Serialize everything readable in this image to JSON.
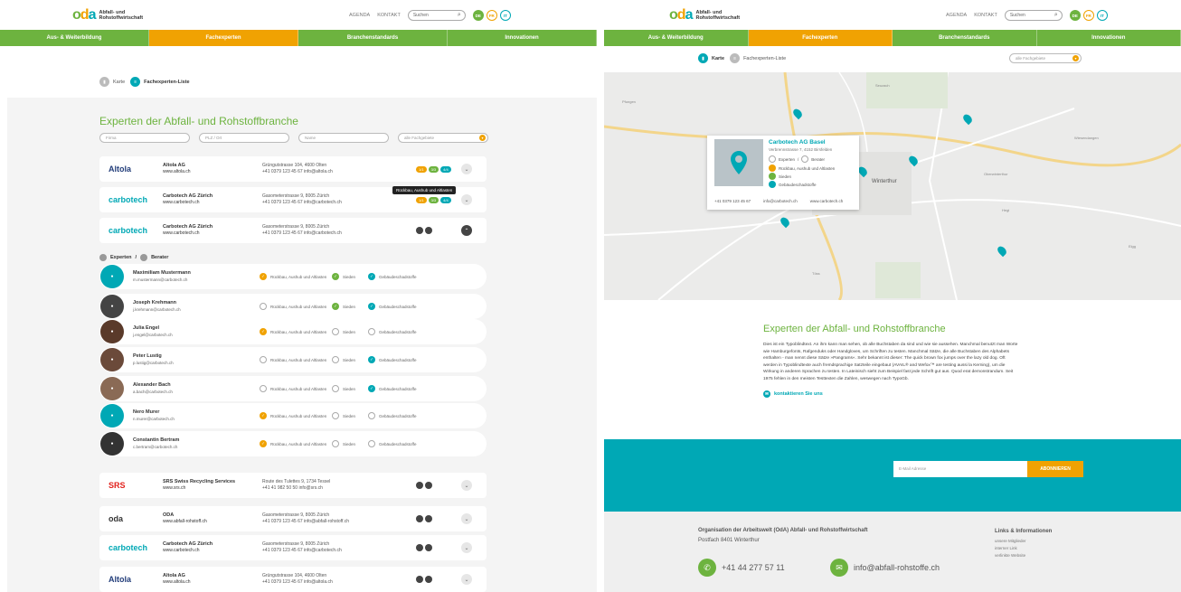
{
  "brand": {
    "mark": "oda",
    "line1": "Abfall- und",
    "line2": "Rohstoffwirtschaft"
  },
  "header": {
    "agenda": "AGENDA",
    "kontakt": "KONTAKT",
    "search_placeholder": "Suchen",
    "langs": [
      "DE",
      "FR",
      "IT"
    ]
  },
  "nav": [
    "Aus- & Weiterbildung",
    "Fachexperten",
    "Branchenstandards",
    "Innovationen"
  ],
  "toggle": {
    "map": "Karte",
    "list": "Fachexperten-Liste"
  },
  "left": {
    "heading": "Experten der Abfall- und Rohstoffbranche",
    "filters": [
      "Firma",
      "PLZ / Ort",
      "Name",
      "alle Fachgebiete"
    ],
    "tooltip": "Rückbau, Aushub und Altlasten",
    "companies_top": [
      {
        "logo": "Altola",
        "name": "Altola AG",
        "web": "www.altola.ch",
        "addr": "Grüngutstrasse 104, 4600 Olten",
        "phone": "+41 0379 123 45 67",
        "mail": "info@altola.ch",
        "badges": [
          "1/1",
          "3/3",
          "4/4"
        ]
      },
      {
        "logo": "carbotech",
        "name": "Carbotech AG Zürich",
        "web": "www.carbotech.ch",
        "addr": "Gasometerstrasse 9, 8005 Zürich",
        "phone": "+41 0379 123 45 67",
        "mail": "info@carbotech.ch",
        "badges": [
          "1/1",
          "3/3",
          "4/4"
        ]
      },
      {
        "logo": "carbotech",
        "name": "Carbotech AG Zürich",
        "web": "www.carbotech.ch",
        "addr": "Gasometerstrasse 9, 8005 Zürich",
        "phone": "+41 0379 123 45 67",
        "mail": "info@carbotech.ch",
        "badges": []
      }
    ],
    "section_label": {
      "experts": "Experten",
      "sep": "/",
      "advisors": "Berater"
    },
    "status_labels": [
      "Rückbau, Aushub und Altlasten",
      "Sieden",
      "Gebäudeschadstoffe"
    ],
    "people": [
      {
        "name": "Maximiliam Mustermann",
        "mail": "m.mustermann@carbotech.ch",
        "s": [
          "o",
          "gr",
          "tl"
        ]
      },
      {
        "name": "Joseph Krehmann",
        "mail": "j.krehmann@carbotech.ch",
        "s": [
          "no",
          "gr",
          "tl"
        ]
      },
      {
        "name": "Julia Engel",
        "mail": "j.engel@carbotech.ch",
        "s": [
          "o",
          "no",
          "no"
        ]
      },
      {
        "name": "Peter Lustig",
        "mail": "p.lustig@carbotech.ch",
        "s": [
          "no",
          "no",
          "tl"
        ]
      },
      {
        "name": "Alexander Bach",
        "mail": "a.bach@carbotech.ch",
        "s": [
          "no",
          "no",
          "tl"
        ]
      },
      {
        "name": "Nero Murer",
        "mail": "n.murer@carbotech.ch",
        "s": [
          "o",
          "no",
          "no"
        ]
      },
      {
        "name": "Constantin Bertram",
        "mail": "c.bertram@carbotech.ch",
        "s": [
          "o",
          "no",
          "no"
        ]
      }
    ],
    "companies_bottom": [
      {
        "logo": "SRS",
        "name": "SRS Swiss Recycling Services",
        "web": "www.srs.ch",
        "addr": "Route des Tulettes 9, 1734 Tessel",
        "phone": "+41 41 982 50 50",
        "mail": "info@srs.ch"
      },
      {
        "logo": "oda",
        "name": "ODA",
        "web": "www.abfall-rohstoff.ch",
        "addr": "Gasometerstrasse 9, 8005 Zürich",
        "phone": "+41 0379 123 45 67",
        "mail": "info@abfall-rohstoff.ch"
      },
      {
        "logo": "carbotech",
        "name": "Carbotech AG Zürich",
        "web": "www.carbotech.ch",
        "addr": "Gasometerstrasse 9, 8005 Zürich",
        "phone": "+41 0379 123 45 67",
        "mail": "info@carbotech.ch"
      },
      {
        "logo": "Altola",
        "name": "Altola AG",
        "web": "www.altola.ch",
        "addr": "Grüngutstrasse 104, 4600 Olten",
        "phone": "+41 0379 123 45 67",
        "mail": "info@altola.ch"
      }
    ]
  },
  "right": {
    "filter": "alle Fachgebiete",
    "map_labels": [
      "Winterthur",
      "Pfungen",
      "Wiesendangen",
      "Seuzach",
      "Oberwinterthur",
      "Hegi",
      "Töss",
      "Elgg"
    ],
    "mapcard": {
      "title": "Carbotech AG Basel",
      "sub": "Verbrennstrasse 7, 4152 Birsfelden",
      "tags": [
        "Experten",
        "Berater"
      ],
      "rows": [
        "Rückbau, Aushub und Altlasten",
        "Sieden",
        "Gebäudeschadstoffe"
      ],
      "phone": "+41 0379 123 45 67",
      "mail": "info@carbotech.ch",
      "web": "www.carbotech.ch"
    },
    "heading": "Experten der Abfall- und Rohstoffbranche",
    "body": "Dies ist ein Typoblindtext. An ihm kann man sehen, ob alle Buchstaben da sind und wie sie aussehen. Manchmal benutzt man Worte wie Hamburgefonts, Rafgenduks oder Handgloves, um Schriften zu testen. Manchmal Sätze, die alle Buchstaben des Alphabets enthalten - man nennt diese Sätze »Pangrams«. Sehr bekannt ist dieser: The quick brown fox jumps over the lazy old dog. Oft werden in Typoblindtexte auch fremdsprachige Satzteile eingebaut (AVAIL® and Wefox™ are testing aussi la Kerning), um die Wirkung in anderen Sprachen zu testen. In Lateinisch sieht zum Beispiel fast jede Schrift gut aus. Quod erat demonstrandum. Seit 1975 fehlen in den meisten Testtexten die Zahlen, weswegen nach TypoGb.",
    "contact": "kontaktieren Sie uns",
    "newsletter": {
      "placeholder": "E-Mail Adresse",
      "button": "ABONNIEREN"
    },
    "footer": {
      "org": "Organisation der Arbeitswelt (OdA) Abfall- und Rohstoffwirtschaft",
      "addr": "Postfach 8401 Winterthur",
      "phone": "+41 44 277 57 11",
      "mail": "info@abfall-rohstoffe.ch",
      "links_title": "Links & Informationen",
      "links": [
        "unsere Mitglieder",
        "interner Link",
        "verlinkte Website"
      ]
    }
  }
}
